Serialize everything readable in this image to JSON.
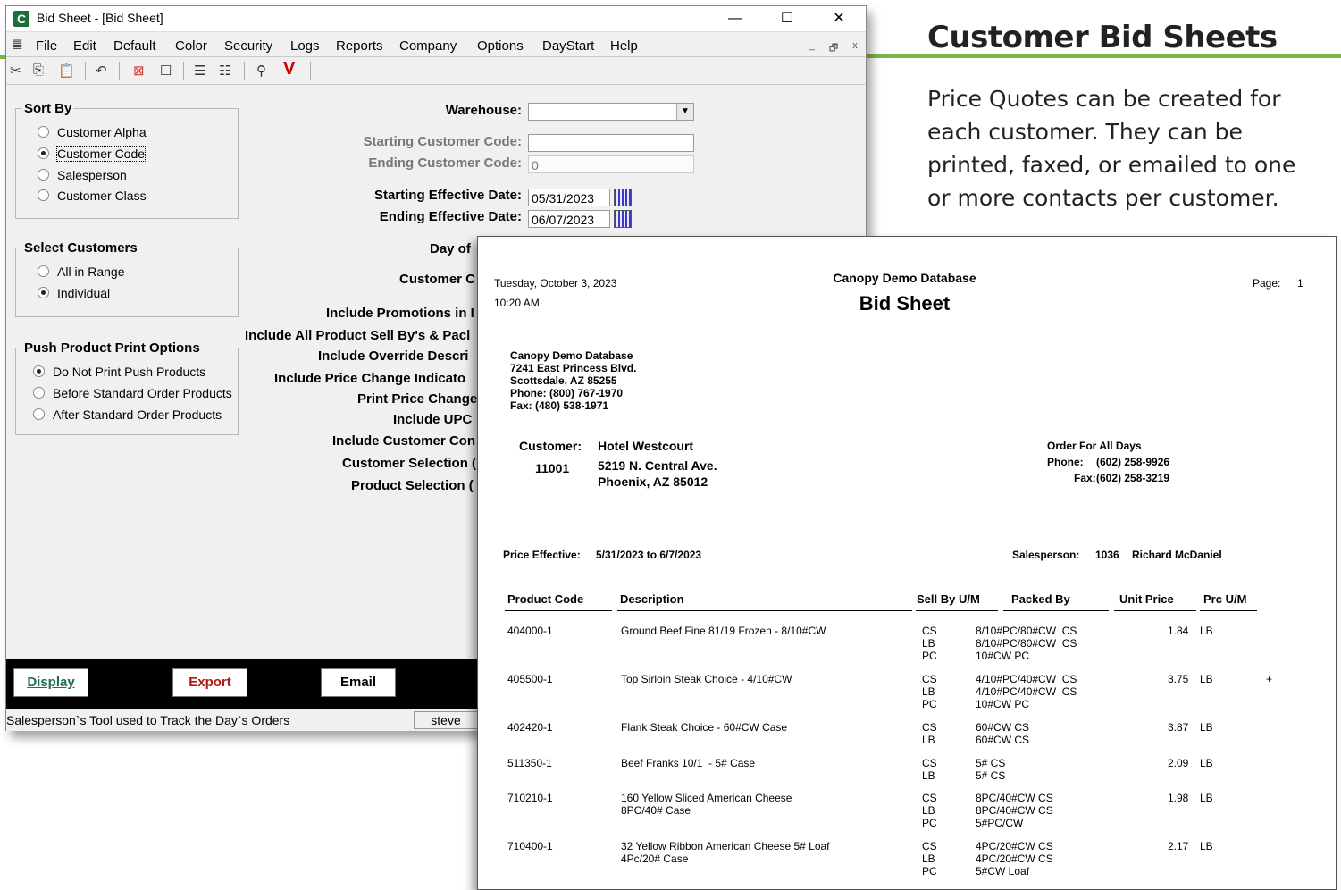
{
  "marketing": {
    "title": "Customer Bid Sheets",
    "body": "Price Quotes can be created for each customer.  They can be printed, faxed, or emailed to one or more contacts per customer."
  },
  "window": {
    "title": "Bid Sheet - [Bid Sheet]",
    "app_icon_letter": "C",
    "controls": {
      "minimize": "—",
      "maximize": "☐",
      "close": "✕"
    }
  },
  "menu": [
    "File",
    "Edit",
    "Default",
    "Color",
    "Security",
    "Logs",
    "Reports",
    "Company",
    "Options",
    "DayStart",
    "Help"
  ],
  "mdi_controls": {
    "minimize": "_",
    "restore": "🗗",
    "close": "x"
  },
  "sort_by": {
    "title": "Sort By",
    "options": [
      "Customer Alpha",
      "Customer Code",
      "Salesperson",
      "Customer Class"
    ],
    "selected": "Customer Code"
  },
  "select_customers": {
    "title": "Select Customers",
    "options": [
      "All in Range",
      "Individual"
    ],
    "selected": "Individual"
  },
  "push_options": {
    "title": "Push Product Print Options",
    "options": [
      "Do Not Print Push Products",
      "Before Standard Order Products",
      "After Standard Order Products"
    ],
    "selected": "Do Not Print Push Products"
  },
  "form": {
    "warehouse_label": "Warehouse:",
    "warehouse_value": "",
    "start_cust_label": "Starting Customer Code:",
    "start_cust_value": "",
    "end_cust_label": "Ending Customer Code:",
    "end_cust_value": "0",
    "start_date_label": "Starting Effective Date:",
    "start_date_value": "05/31/2023",
    "end_date_label": "Ending Effective Date:",
    "end_date_value": "06/07/2023",
    "truncated_labels": [
      "Day of",
      "Customer C",
      "Include Promotions in I",
      "Include All Product Sell By's & Pacl",
      "Include Override Descri",
      "Include Price Change Indicato",
      "Print Price Change",
      "Include UPC",
      "Include Customer Con",
      "Customer Selection (",
      "Product Selection ("
    ]
  },
  "buttons": {
    "display": "Display",
    "export": "Export",
    "email": "Email"
  },
  "status": {
    "text": "Salesperson`s Tool used to Track the Day`s Orders",
    "user": "steve"
  },
  "report": {
    "date": "Tuesday, October 3, 2023",
    "time": "10:20 AM",
    "company": "Canopy Demo Database",
    "title": "Bid Sheet",
    "page_label": "Page:",
    "page_num": "1",
    "address": [
      "Canopy Demo Database",
      "7241 East Princess Blvd.",
      "Scottsdale, AZ 85255",
      "Phone:  (800) 767-1970",
      "Fax:  (480) 538-1971"
    ],
    "customer_label": "Customer:",
    "customer_name": "Hotel Westcourt",
    "customer_code": "11001",
    "customer_addr1": "5219 N. Central Ave.",
    "customer_addr2": "Phoenix, AZ 85012",
    "order_for": "Order For All Days",
    "phone_label": "Phone:",
    "phone": "(602) 258-9926",
    "fax_label": "Fax:",
    "fax": "(602) 258-3219",
    "price_effective_label": "Price Effective:",
    "price_effective": "5/31/2023 to 6/7/2023",
    "salesperson_label": "Salesperson:",
    "salesperson_code": "1036",
    "salesperson_name": "Richard McDaniel",
    "columns": [
      "Product Code",
      "Description",
      "Sell By U/M",
      "Packed By",
      "Unit Price",
      "Prc U/M"
    ],
    "rows": [
      {
        "code": "404000-1",
        "desc": "Ground Beef Fine 81/19 Frozen - 8/10#CW",
        "sellby": "CS\nLB\nPC",
        "packed": "8/10#PC/80#CW  CS\n8/10#PC/80#CW  CS\n10#CW PC",
        "price": "1.84",
        "uom": "LB",
        "flag": ""
      },
      {
        "code": "405500-1",
        "desc": "Top Sirloin Steak Choice - 4/10#CW",
        "sellby": "CS\nLB\nPC",
        "packed": "4/10#PC/40#CW  CS\n4/10#PC/40#CW  CS\n10#CW PC",
        "price": "3.75",
        "uom": "LB",
        "flag": "+"
      },
      {
        "code": "402420-1",
        "desc": "Flank Steak Choice - 60#CW Case",
        "sellby": "CS\nLB",
        "packed": "60#CW CS\n60#CW CS",
        "price": "3.87",
        "uom": "LB",
        "flag": ""
      },
      {
        "code": "511350-1",
        "desc": "Beef Franks 10/1  - 5# Case",
        "sellby": "CS\nLB",
        "packed": "5# CS\n5# CS",
        "price": "2.09",
        "uom": "LB",
        "flag": ""
      },
      {
        "code": "710210-1",
        "desc": "160 Yellow Sliced American Cheese\n8PC/40# Case",
        "sellby": "CS\nLB\nPC",
        "packed": "8PC/40#CW CS\n8PC/40#CW CS\n5#PC/CW",
        "price": "1.98",
        "uom": "LB",
        "flag": ""
      },
      {
        "code": "710400-1",
        "desc": "32 Yellow Ribbon American Cheese 5# Loaf\n4Pc/20# Case",
        "sellby": "CS\nLB\nPC",
        "packed": "4PC/20#CW CS\n4PC/20#CW CS\n5#CW Loaf",
        "price": "2.17",
        "uom": "LB",
        "flag": ""
      }
    ]
  }
}
